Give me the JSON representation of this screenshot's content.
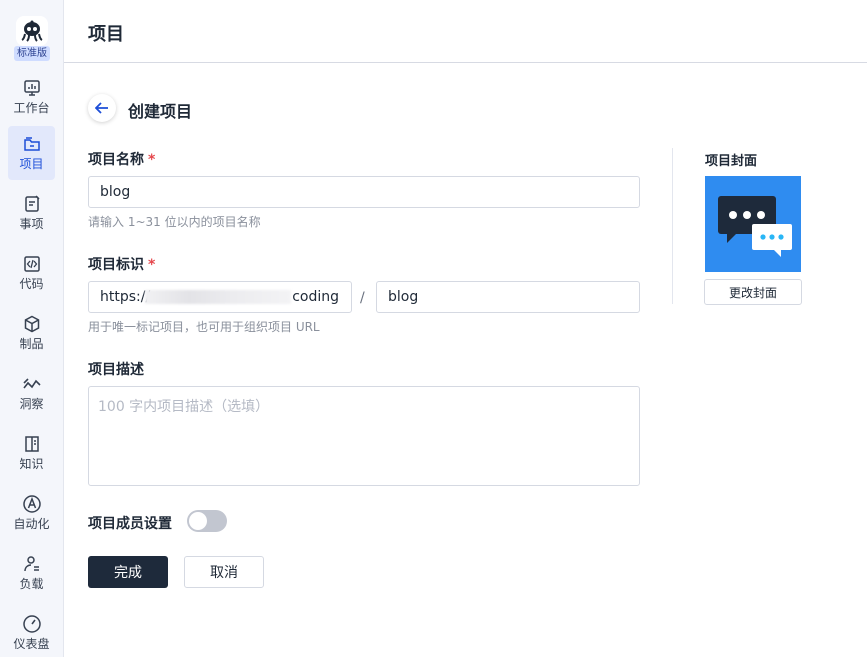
{
  "sidebar": {
    "edition_badge": "标准版",
    "items": [
      {
        "label": "工作台",
        "icon": "dashboard-icon"
      },
      {
        "label": "项目",
        "icon": "folder-icon"
      },
      {
        "label": "事项",
        "icon": "task-icon"
      },
      {
        "label": "代码",
        "icon": "code-icon"
      },
      {
        "label": "制品",
        "icon": "package-icon"
      },
      {
        "label": "洞察",
        "icon": "insight-icon"
      },
      {
        "label": "知识",
        "icon": "book-icon"
      },
      {
        "label": "自动化",
        "icon": "automation-icon"
      },
      {
        "label": "负载",
        "icon": "workload-icon"
      },
      {
        "label": "仪表盘",
        "icon": "gauge-icon"
      }
    ],
    "active_item": "项目"
  },
  "header": {
    "title": "项目"
  },
  "form": {
    "subtitle": "创建项目",
    "name": {
      "label": "项目名称",
      "required_mark": "*",
      "value": "blog",
      "hint": "请输入 1~31 位以内的项目名称"
    },
    "identifier": {
      "label": "项目标识",
      "required_mark": "*",
      "url_prefix_start": "https://",
      "url_prefix_end": "coding",
      "separator": "/",
      "value": "blog",
      "hint": "用于唯一标记项目，也可用于组织项目 URL"
    },
    "description": {
      "label": "项目描述",
      "placeholder": "100 字内项目描述（选填）",
      "value": ""
    },
    "members": {
      "label": "项目成员设置",
      "enabled": false
    },
    "submit_label": "完成",
    "cancel_label": "取消"
  },
  "cover": {
    "label": "项目封面",
    "change_label": "更改封面",
    "icon": "chat-bubbles-icon",
    "background": "#2f8cf0"
  },
  "colors": {
    "primary_button": "#1e2a3b",
    "required": "#e5484d",
    "active_nav": "#e2e8fb",
    "accent": "#1d4ed8"
  }
}
